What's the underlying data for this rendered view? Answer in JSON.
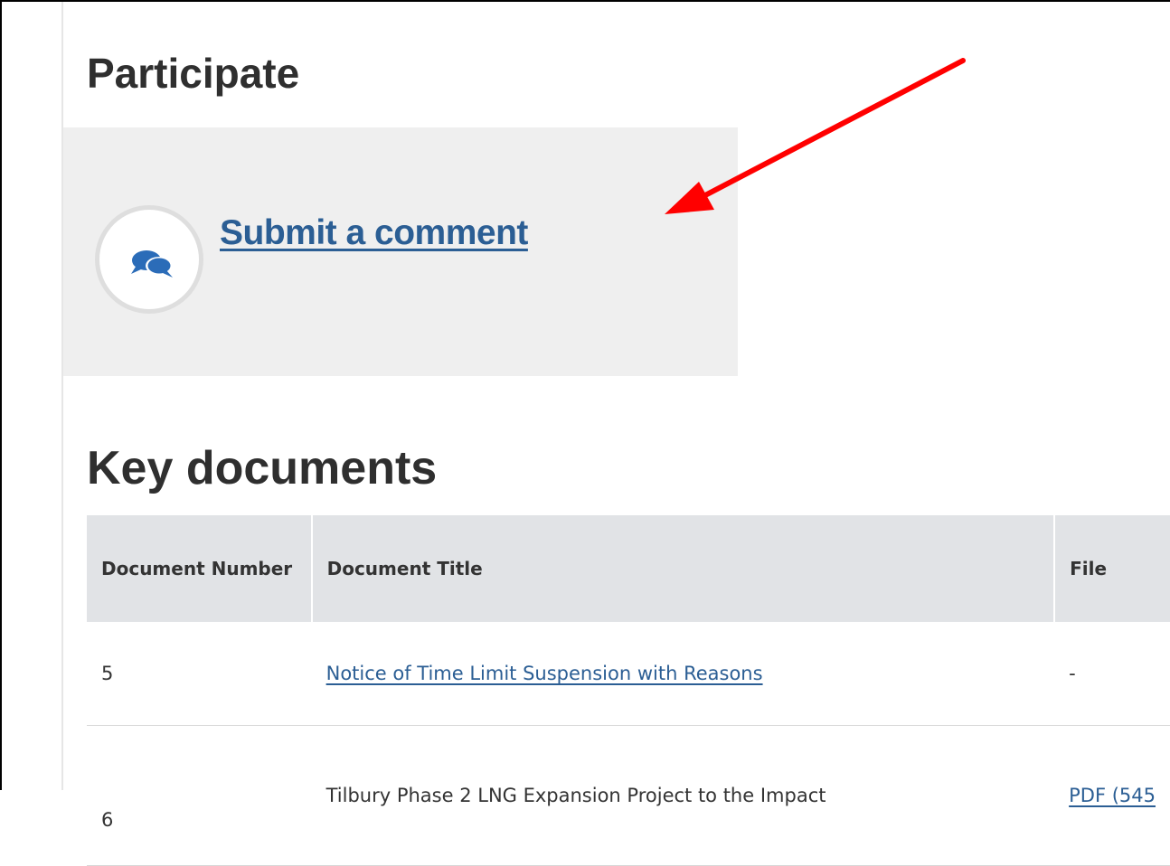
{
  "participate": {
    "heading": "Participate",
    "submit_comment_label": "Submit a comment",
    "icon": "comments-icon"
  },
  "key_documents": {
    "heading": "Key documents",
    "columns": [
      "Document Number",
      "Document Title",
      "File"
    ],
    "rows": [
      {
        "number": "5",
        "title": "Notice of Time Limit Suspension with Reasons",
        "file": "-"
      },
      {
        "number": "6",
        "title": "Tilbury Phase 2 LNG Expansion Project to the Impact",
        "file": "PDF (545"
      }
    ]
  },
  "colors": {
    "link": "#2b5e94",
    "arrow": "#ff0000",
    "panel_background": "#efefef",
    "table_header_background": "#e1e3e6"
  }
}
